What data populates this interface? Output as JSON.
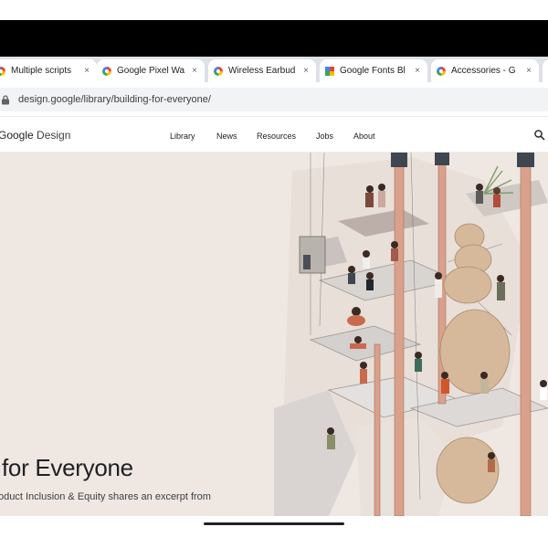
{
  "browser": {
    "tabs": [
      {
        "title": "Multiple scripts",
        "favicon": "google-favicon"
      },
      {
        "title": "Google Pixel Wa",
        "favicon": "google-favicon"
      },
      {
        "title": "Wireless Earbud",
        "favicon": "google-favicon"
      },
      {
        "title": "Google Fonts Bl",
        "favicon": "google-fonts-favicon"
      },
      {
        "title": "Accessories - G",
        "favicon": "google-favicon"
      }
    ],
    "close_glyph": "×",
    "url": "design.google/library/building-for-everyone/"
  },
  "site": {
    "logo_google": "Google",
    "logo_design": " Design",
    "nav": [
      {
        "label": "Library"
      },
      {
        "label": "News"
      },
      {
        "label": "Resources"
      },
      {
        "label": "Jobs"
      },
      {
        "label": "About"
      }
    ],
    "search_icon": "search-icon"
  },
  "hero": {
    "title": "for Everyone",
    "subtitle": "oduct Inclusion & Equity shares an excerpt from"
  },
  "colors": {
    "hero_bg": "#efe7e2",
    "tabstrip_bg": "#dee1e6",
    "accent_pole": "#d9a18b"
  }
}
